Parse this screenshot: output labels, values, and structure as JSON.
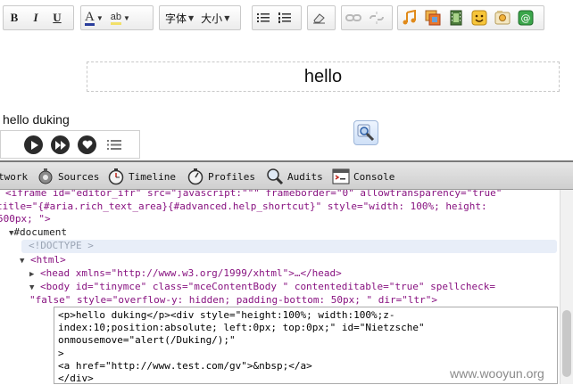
{
  "toolbar": {
    "bold": "B",
    "italic": "I",
    "underline": "U",
    "font_color": "A",
    "highlight": "ab",
    "font_family": "字体",
    "font_size": "大小"
  },
  "editor": {
    "content": "hello"
  },
  "player": {
    "title": "hello duking"
  },
  "devtools": {
    "tabs": [
      {
        "label": "twork"
      },
      {
        "label": "Sources"
      },
      {
        "label": "Timeline"
      },
      {
        "label": "Profiles"
      },
      {
        "label": "Audits"
      },
      {
        "label": "Console"
      }
    ],
    "code": {
      "iframe_line1": "<iframe id=\"editor_ifr\" src=\"javascript:\"\"\" frameborder=\"0\" allowtransparency=\"true\"",
      "iframe_line2": "title=\"{#aria.rich_text_area}{#advanced.help_shortcut}\" style=\"width: 100%; height:",
      "iframe_line3": "500px; \">",
      "document": "#document",
      "doctype": "<!DOCTYPE >",
      "html_open": "<html>",
      "head": "<head xmlns=\"http://www.w3.org/1999/xhtml\">…</head>",
      "body_line1": "<body id=\"tinymce\" class=\"mceContentBody \" contenteditable=\"true\" spellcheck=",
      "body_line2": "\"false\" style=\"overflow-y: hidden; padding-bottom: 50px; \" dir=\"ltr\">"
    },
    "edit_lines": [
      "<p>hello duking</p><div style=\"height:100%; width:100%;z-",
      "index:10;position:absolute; left:0px; top:0px;\" id=\"Nietzsche\"",
      "onmousemove=\"alert(/Duking/);\"",
      ">",
      "<a href=\"http://www.test.com/gv\">&nbsp;</a>",
      "</div>"
    ]
  },
  "watermark": "www.wooyun.org"
}
